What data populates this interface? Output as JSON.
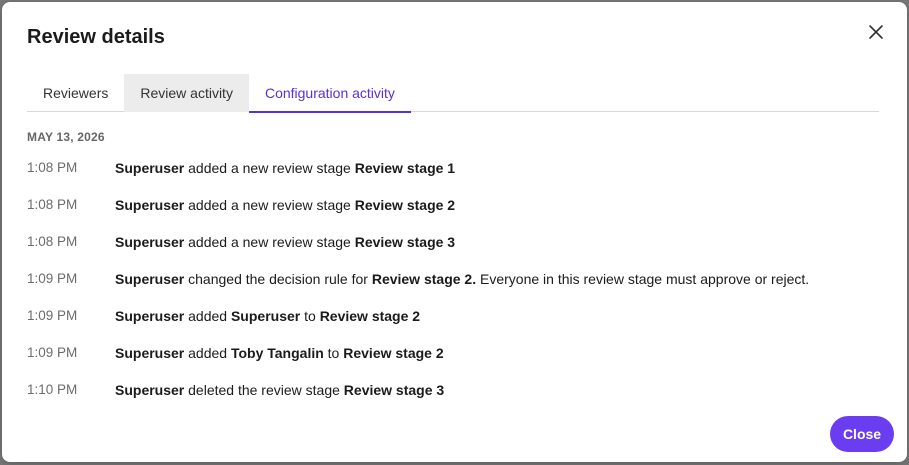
{
  "dialog": {
    "title": "Review details",
    "close_icon": "close-icon",
    "close_button_label": "Close"
  },
  "tabs": [
    {
      "label": "Reviewers",
      "state": "normal"
    },
    {
      "label": "Review activity",
      "state": "hover"
    },
    {
      "label": "Configuration activity",
      "state": "active"
    }
  ],
  "date_header": "MAY 13, 2026",
  "activities": [
    {
      "time": "1:08 PM",
      "parts": [
        {
          "t": "Superuser",
          "b": true
        },
        {
          "t": " added a new review stage ",
          "b": false
        },
        {
          "t": "Review stage 1",
          "b": true
        }
      ]
    },
    {
      "time": "1:08 PM",
      "parts": [
        {
          "t": "Superuser",
          "b": true
        },
        {
          "t": " added a new review stage ",
          "b": false
        },
        {
          "t": "Review stage 2",
          "b": true
        }
      ]
    },
    {
      "time": "1:08 PM",
      "parts": [
        {
          "t": "Superuser",
          "b": true
        },
        {
          "t": " added a new review stage ",
          "b": false
        },
        {
          "t": "Review stage 3",
          "b": true
        }
      ]
    },
    {
      "time": "1:09 PM",
      "parts": [
        {
          "t": "Superuser",
          "b": true
        },
        {
          "t": " changed the decision rule for ",
          "b": false
        },
        {
          "t": "Review stage 2.",
          "b": true
        },
        {
          "t": " Everyone in this review stage must approve or reject.",
          "b": false
        }
      ]
    },
    {
      "time": "1:09 PM",
      "parts": [
        {
          "t": "Superuser",
          "b": true
        },
        {
          "t": " added ",
          "b": false
        },
        {
          "t": "Superuser",
          "b": true
        },
        {
          "t": " to ",
          "b": false
        },
        {
          "t": "Review stage 2",
          "b": true
        }
      ]
    },
    {
      "time": "1:09 PM",
      "parts": [
        {
          "t": "Superuser",
          "b": true
        },
        {
          "t": " added ",
          "b": false
        },
        {
          "t": "Toby Tangalin",
          "b": true
        },
        {
          "t": " to ",
          "b": false
        },
        {
          "t": "Review stage 2",
          "b": true
        }
      ]
    },
    {
      "time": "1:10 PM",
      "parts": [
        {
          "t": "Superuser",
          "b": true
        },
        {
          "t": " deleted the review stage ",
          "b": false
        },
        {
          "t": "Review stage 3",
          "b": true
        }
      ]
    }
  ],
  "colors": {
    "accent": "#6a3df0",
    "active_tab": "#5b2fd6",
    "hover_tab_bg": "#ececec"
  }
}
